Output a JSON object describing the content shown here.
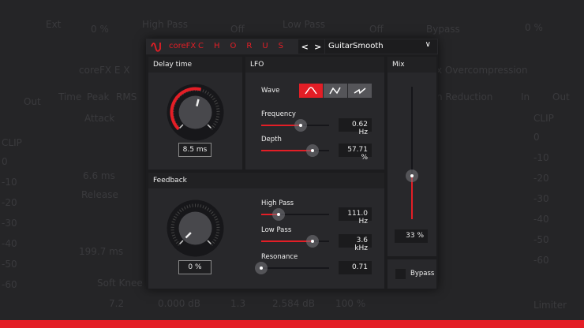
{
  "background": {
    "top": [
      "Ext",
      "0 %",
      "High Pass",
      "Off",
      "Low Pass",
      "Off",
      "Bypass",
      "0 %"
    ],
    "left": [
      "Out",
      "Time",
      "Peak",
      "RMS",
      "Attack",
      "6.6 ms",
      "Release",
      "199.7 ms",
      "Soft Knee",
      "7.2",
      "0.000 dB",
      "1.3",
      "2.584 dB",
      "100 %",
      "coreFX E X"
    ],
    "right": [
      "x Overcompression",
      "n Reduction",
      "In",
      "Out",
      "Limiter"
    ],
    "meter_left": [
      "CLIP",
      "0",
      "-10",
      "-20",
      "-30",
      "-40",
      "-50",
      "-60"
    ],
    "meter_right": [
      "CLIP",
      "0",
      "-10",
      "-20",
      "-30",
      "-40",
      "-50",
      "-60"
    ]
  },
  "header": {
    "brand": "coreFX",
    "title": "CHORUS",
    "prev": "<",
    "next": ">",
    "preset": "GuitarSmooth"
  },
  "delay": {
    "title": "Delay time",
    "value": "8.5 ms",
    "knob_fraction": 0.55
  },
  "lfo": {
    "title": "LFO",
    "wave_label": "Wave",
    "waves": [
      "sine",
      "triangle",
      "saw"
    ],
    "selected_wave": 0,
    "frequency": {
      "label": "Frequency",
      "value": "0.62 Hz",
      "fraction": 0.58
    },
    "depth": {
      "label": "Depth",
      "value": "57.71 %",
      "fraction": 0.75
    }
  },
  "mix": {
    "title": "Mix",
    "value": "33 %",
    "fraction": 0.33
  },
  "bypass": {
    "label": "Bypass",
    "checked": false
  },
  "feedback": {
    "title": "Feedback",
    "value": "0 %",
    "knob_fraction": 0,
    "high_pass": {
      "label": "High Pass",
      "value": "111.0 Hz",
      "fraction": 0.25
    },
    "low_pass": {
      "label": "Low Pass",
      "value": "3.6 kHz",
      "fraction": 0.75
    },
    "resonance": {
      "label": "Resonance",
      "value": "0.71",
      "fraction": 0
    }
  },
  "colors": {
    "accent": "#e31e26",
    "panel": "#28282b"
  }
}
